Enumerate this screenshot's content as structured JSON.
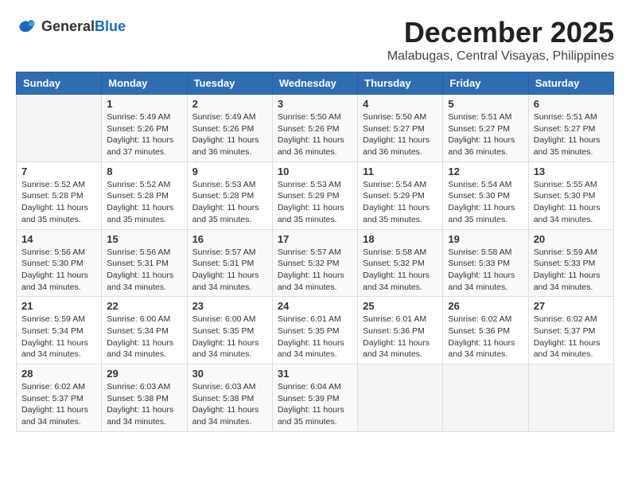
{
  "header": {
    "logo_general": "General",
    "logo_blue": "Blue",
    "month_title": "December 2025",
    "location": "Malabugas, Central Visayas, Philippines"
  },
  "days_of_week": [
    "Sunday",
    "Monday",
    "Tuesday",
    "Wednesday",
    "Thursday",
    "Friday",
    "Saturday"
  ],
  "weeks": [
    [
      {
        "day": "",
        "sunrise": "",
        "sunset": "",
        "daylight": ""
      },
      {
        "day": "1",
        "sunrise": "Sunrise: 5:49 AM",
        "sunset": "Sunset: 5:26 PM",
        "daylight": "Daylight: 11 hours and 37 minutes."
      },
      {
        "day": "2",
        "sunrise": "Sunrise: 5:49 AM",
        "sunset": "Sunset: 5:26 PM",
        "daylight": "Daylight: 11 hours and 36 minutes."
      },
      {
        "day": "3",
        "sunrise": "Sunrise: 5:50 AM",
        "sunset": "Sunset: 5:26 PM",
        "daylight": "Daylight: 11 hours and 36 minutes."
      },
      {
        "day": "4",
        "sunrise": "Sunrise: 5:50 AM",
        "sunset": "Sunset: 5:27 PM",
        "daylight": "Daylight: 11 hours and 36 minutes."
      },
      {
        "day": "5",
        "sunrise": "Sunrise: 5:51 AM",
        "sunset": "Sunset: 5:27 PM",
        "daylight": "Daylight: 11 hours and 36 minutes."
      },
      {
        "day": "6",
        "sunrise": "Sunrise: 5:51 AM",
        "sunset": "Sunset: 5:27 PM",
        "daylight": "Daylight: 11 hours and 35 minutes."
      }
    ],
    [
      {
        "day": "7",
        "sunrise": "Sunrise: 5:52 AM",
        "sunset": "Sunset: 5:28 PM",
        "daylight": "Daylight: 11 hours and 35 minutes."
      },
      {
        "day": "8",
        "sunrise": "Sunrise: 5:52 AM",
        "sunset": "Sunset: 5:28 PM",
        "daylight": "Daylight: 11 hours and 35 minutes."
      },
      {
        "day": "9",
        "sunrise": "Sunrise: 5:53 AM",
        "sunset": "Sunset: 5:28 PM",
        "daylight": "Daylight: 11 hours and 35 minutes."
      },
      {
        "day": "10",
        "sunrise": "Sunrise: 5:53 AM",
        "sunset": "Sunset: 5:29 PM",
        "daylight": "Daylight: 11 hours and 35 minutes."
      },
      {
        "day": "11",
        "sunrise": "Sunrise: 5:54 AM",
        "sunset": "Sunset: 5:29 PM",
        "daylight": "Daylight: 11 hours and 35 minutes."
      },
      {
        "day": "12",
        "sunrise": "Sunrise: 5:54 AM",
        "sunset": "Sunset: 5:30 PM",
        "daylight": "Daylight: 11 hours and 35 minutes."
      },
      {
        "day": "13",
        "sunrise": "Sunrise: 5:55 AM",
        "sunset": "Sunset: 5:30 PM",
        "daylight": "Daylight: 11 hours and 34 minutes."
      }
    ],
    [
      {
        "day": "14",
        "sunrise": "Sunrise: 5:56 AM",
        "sunset": "Sunset: 5:30 PM",
        "daylight": "Daylight: 11 hours and 34 minutes."
      },
      {
        "day": "15",
        "sunrise": "Sunrise: 5:56 AM",
        "sunset": "Sunset: 5:31 PM",
        "daylight": "Daylight: 11 hours and 34 minutes."
      },
      {
        "day": "16",
        "sunrise": "Sunrise: 5:57 AM",
        "sunset": "Sunset: 5:31 PM",
        "daylight": "Daylight: 11 hours and 34 minutes."
      },
      {
        "day": "17",
        "sunrise": "Sunrise: 5:57 AM",
        "sunset": "Sunset: 5:32 PM",
        "daylight": "Daylight: 11 hours and 34 minutes."
      },
      {
        "day": "18",
        "sunrise": "Sunrise: 5:58 AM",
        "sunset": "Sunset: 5:32 PM",
        "daylight": "Daylight: 11 hours and 34 minutes."
      },
      {
        "day": "19",
        "sunrise": "Sunrise: 5:58 AM",
        "sunset": "Sunset: 5:33 PM",
        "daylight": "Daylight: 11 hours and 34 minutes."
      },
      {
        "day": "20",
        "sunrise": "Sunrise: 5:59 AM",
        "sunset": "Sunset: 5:33 PM",
        "daylight": "Daylight: 11 hours and 34 minutes."
      }
    ],
    [
      {
        "day": "21",
        "sunrise": "Sunrise: 5:59 AM",
        "sunset": "Sunset: 5:34 PM",
        "daylight": "Daylight: 11 hours and 34 minutes."
      },
      {
        "day": "22",
        "sunrise": "Sunrise: 6:00 AM",
        "sunset": "Sunset: 5:34 PM",
        "daylight": "Daylight: 11 hours and 34 minutes."
      },
      {
        "day": "23",
        "sunrise": "Sunrise: 6:00 AM",
        "sunset": "Sunset: 5:35 PM",
        "daylight": "Daylight: 11 hours and 34 minutes."
      },
      {
        "day": "24",
        "sunrise": "Sunrise: 6:01 AM",
        "sunset": "Sunset: 5:35 PM",
        "daylight": "Daylight: 11 hours and 34 minutes."
      },
      {
        "day": "25",
        "sunrise": "Sunrise: 6:01 AM",
        "sunset": "Sunset: 5:36 PM",
        "daylight": "Daylight: 11 hours and 34 minutes."
      },
      {
        "day": "26",
        "sunrise": "Sunrise: 6:02 AM",
        "sunset": "Sunset: 5:36 PM",
        "daylight": "Daylight: 11 hours and 34 minutes."
      },
      {
        "day": "27",
        "sunrise": "Sunrise: 6:02 AM",
        "sunset": "Sunset: 5:37 PM",
        "daylight": "Daylight: 11 hours and 34 minutes."
      }
    ],
    [
      {
        "day": "28",
        "sunrise": "Sunrise: 6:02 AM",
        "sunset": "Sunset: 5:37 PM",
        "daylight": "Daylight: 11 hours and 34 minutes."
      },
      {
        "day": "29",
        "sunrise": "Sunrise: 6:03 AM",
        "sunset": "Sunset: 5:38 PM",
        "daylight": "Daylight: 11 hours and 34 minutes."
      },
      {
        "day": "30",
        "sunrise": "Sunrise: 6:03 AM",
        "sunset": "Sunset: 5:38 PM",
        "daylight": "Daylight: 11 hours and 34 minutes."
      },
      {
        "day": "31",
        "sunrise": "Sunrise: 6:04 AM",
        "sunset": "Sunset: 5:39 PM",
        "daylight": "Daylight: 11 hours and 35 minutes."
      },
      {
        "day": "",
        "sunrise": "",
        "sunset": "",
        "daylight": ""
      },
      {
        "day": "",
        "sunrise": "",
        "sunset": "",
        "daylight": ""
      },
      {
        "day": "",
        "sunrise": "",
        "sunset": "",
        "daylight": ""
      }
    ]
  ]
}
